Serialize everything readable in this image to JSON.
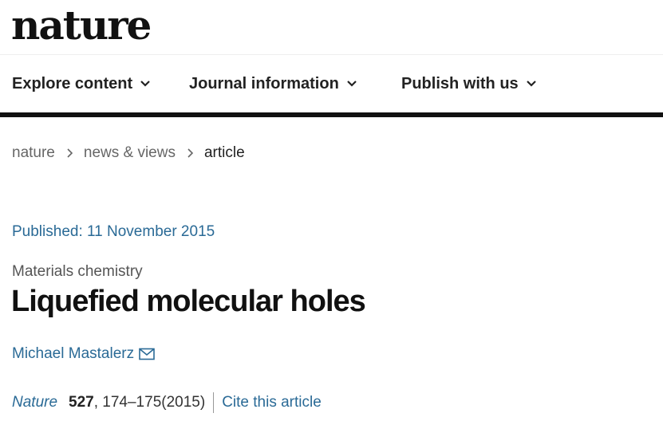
{
  "header": {
    "logo_text": "nature"
  },
  "nav": {
    "items": [
      {
        "label": "Explore content"
      },
      {
        "label": "Journal information"
      },
      {
        "label": "Publish with us"
      }
    ]
  },
  "breadcrumb": {
    "items": [
      "nature",
      "news & views",
      "article"
    ]
  },
  "article": {
    "published": "Published: 11 November 2015",
    "subject": "Materials chemistry",
    "title": "Liquefied molecular holes",
    "author": "Michael Mastalerz",
    "citation": {
      "journal": "Nature",
      "volume": "527",
      "pages": ", 174–175(2015)",
      "cite_label": "Cite this article"
    }
  },
  "colors": {
    "link": "#2a6a96",
    "text": "#222222",
    "muted": "#666666",
    "rule": "#111111"
  },
  "icons": {
    "nav_chevron": "chevron-down-icon",
    "breadcrumb_separator": "chevron-right-icon",
    "author_contact": "mail-icon"
  }
}
